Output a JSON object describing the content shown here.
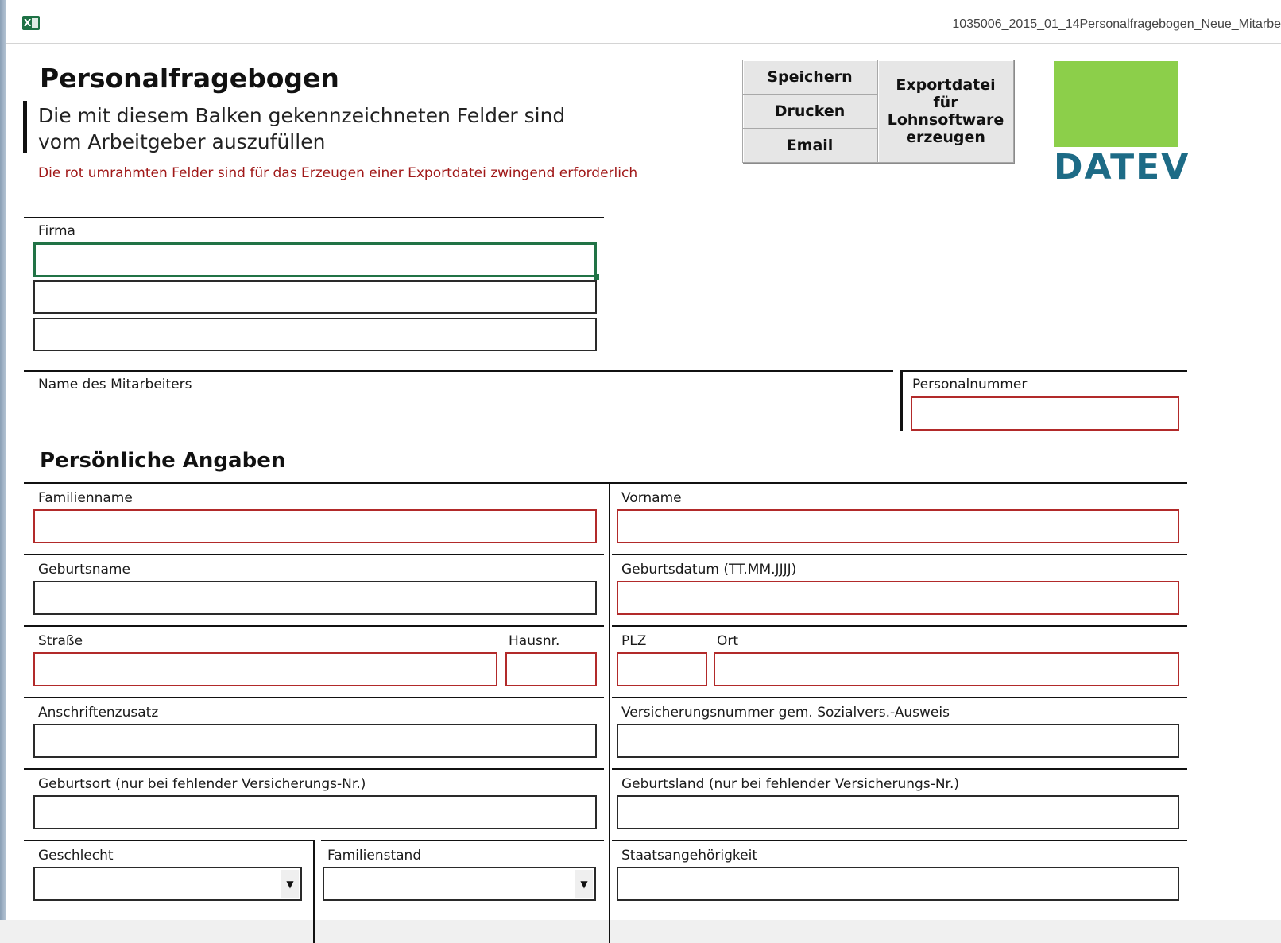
{
  "window": {
    "app_icon": "excel-icon",
    "title": "1035006_2015_01_14Personalfragebogen_Neue_Mitarbe"
  },
  "header": {
    "title": "Personalfragebogen",
    "subtitle_line1": "Die mit diesem Balken gekennzeichneten Felder sind",
    "subtitle_line2": "vom Arbeitgeber auszufüllen",
    "required_note": "Die rot umrahmten Felder sind für das Erzeugen einer Exportdatei zwingend erforderlich"
  },
  "buttons": {
    "save": "Speichern",
    "print": "Drucken",
    "email": "Email",
    "export_line1": "Exportdatei",
    "export_line2": "für",
    "export_line3": "Lohnsoftware",
    "export_line4": "erzeugen"
  },
  "logo": {
    "text": "DATEV",
    "color": "#8ccf4a",
    "text_color": "#1d6b86"
  },
  "company": {
    "label": "Firma",
    "values": [
      "",
      "",
      ""
    ]
  },
  "employee": {
    "name_label": "Name des Mitarbeiters",
    "personnel_number_label": "Personalnummer",
    "personnel_number": ""
  },
  "personal": {
    "section_title": "Persönliche Angaben",
    "family_name": "Familienname",
    "first_name": "Vorname",
    "birth_name": "Geburtsname",
    "birth_date": "Geburtsdatum (TT.MM.JJJJ)",
    "street": "Straße",
    "house_number": "Hausnr.",
    "zip": "PLZ",
    "city": "Ort",
    "address_addition": "Anschriftenzusatz",
    "insurance_number": "Versicherungsnummer gem. Sozialvers.-Ausweis",
    "birth_place": "Geburtsort (nur bei fehlender Versicherungs-Nr.)",
    "birth_country": "Geburtsland (nur bei fehlender Versicherungs-Nr.)",
    "gender": "Geschlecht",
    "marital_status": "Familienstand",
    "nationality": "Staatsangehörigkeit",
    "gender_value": "",
    "marital_status_value": ""
  },
  "colors": {
    "required_border": "#b22a2a",
    "active_border": "#217346"
  }
}
